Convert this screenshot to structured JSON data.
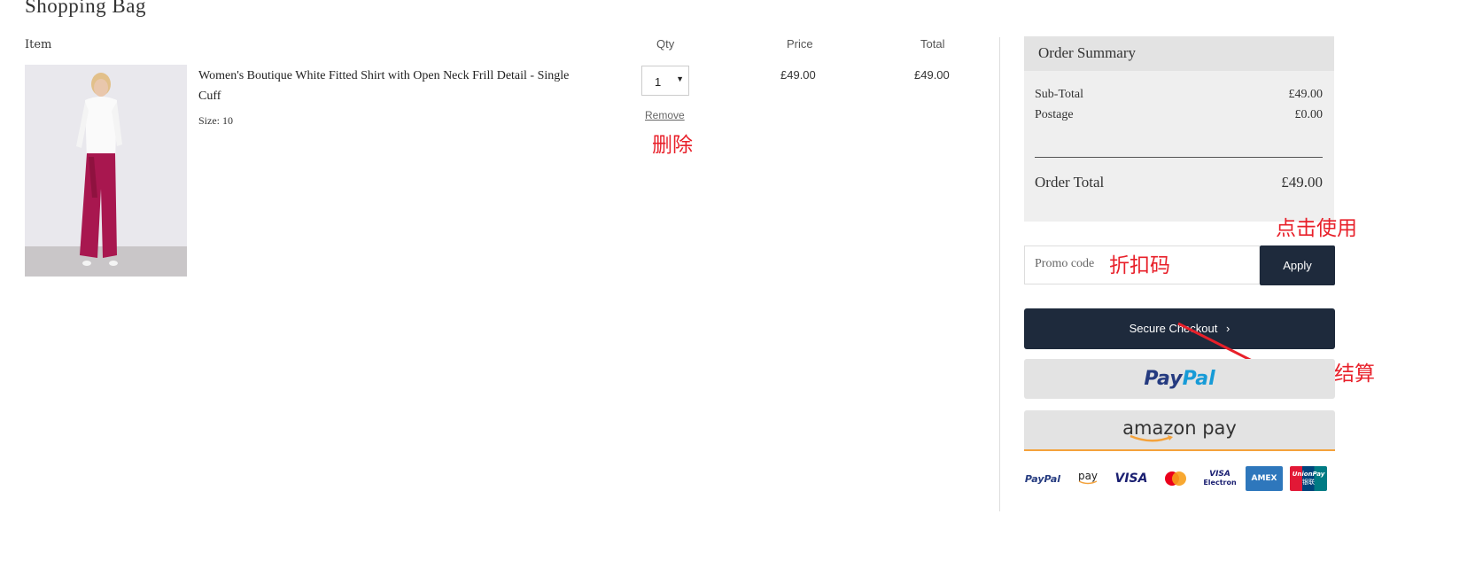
{
  "page": {
    "title": "Shopping Bag"
  },
  "bag": {
    "headers": {
      "item": "Item",
      "qty": "Qty",
      "price": "Price",
      "total": "Total"
    },
    "item": {
      "name": "Women's Boutique White Fitted Shirt with Open Neck Frill Detail - Single Cuff",
      "size": "Size: 10",
      "qty": "1",
      "price": "£49.00",
      "total": "£49.00",
      "remove_label": "Remove"
    }
  },
  "summary": {
    "title": "Order Summary",
    "subtotal_label": "Sub-Total",
    "subtotal_value": "£49.00",
    "postage_label": "Postage",
    "postage_value": "£0.00",
    "total_label": "Order Total",
    "total_value": "£49.00"
  },
  "promo": {
    "placeholder": "Promo code",
    "apply_label": "Apply"
  },
  "checkout": {
    "secure_label": "Secure Checkout",
    "paypal_label_1": "Pay",
    "paypal_label_2": "Pal",
    "amazon_label": "amazon pay"
  },
  "payment_icons": {
    "paypal": "PayPal",
    "applepay": "pay",
    "visa": "VISA",
    "visa_electron_1": "VISA",
    "visa_electron_2": "Electron",
    "amex": "AMEX",
    "unionpay_1": "UnionPay",
    "unionpay_2": "银联"
  },
  "annotations": {
    "remove": "删除",
    "apply": "点击使用",
    "promo": "折扣码",
    "checkout": "开始结算"
  },
  "colors": {
    "navy": "#1e2a3c",
    "annotation_red": "#e8202a",
    "amazon_orange": "#f4a23b"
  }
}
